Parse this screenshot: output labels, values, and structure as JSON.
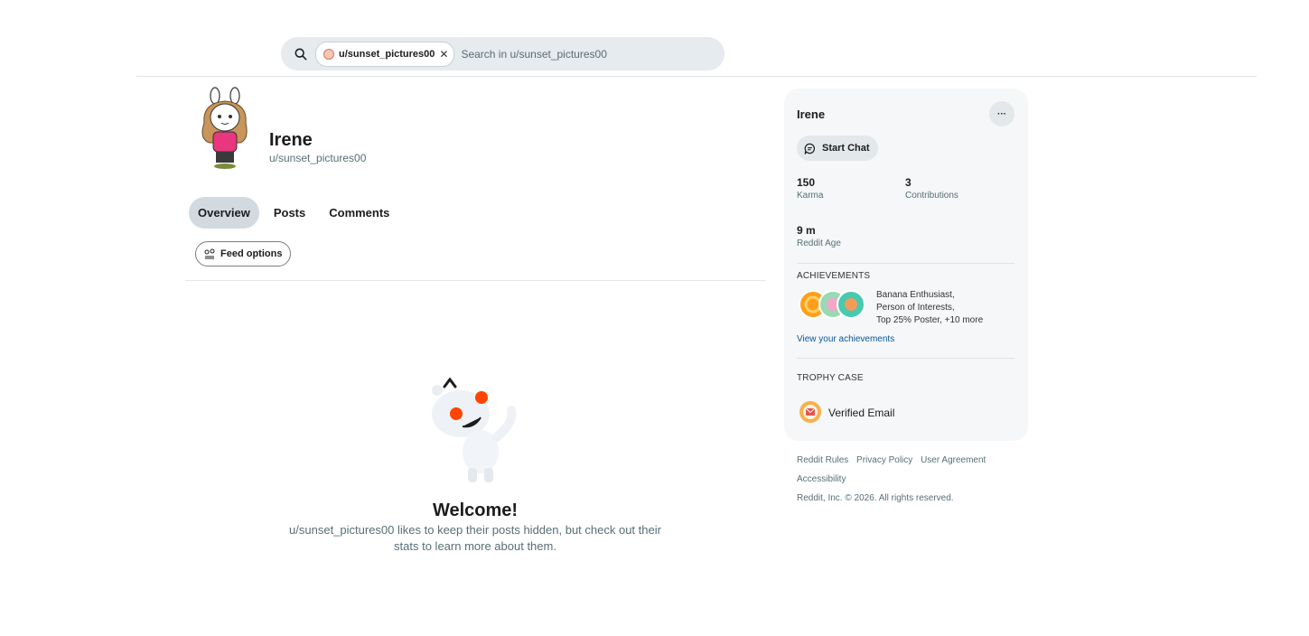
{
  "search": {
    "chip_label": "u/sunset_pictures00",
    "placeholder": "Search in u/sunset_pictures00"
  },
  "profile": {
    "display_name": "Irene",
    "username": "u/sunset_pictures00"
  },
  "tabs": [
    {
      "label": "Overview",
      "active": true
    },
    {
      "label": "Posts",
      "active": false
    },
    {
      "label": "Comments",
      "active": false
    }
  ],
  "feed_options_label": "Feed options",
  "welcome": {
    "title": "Welcome!",
    "description": "u/sunset_pictures00 likes to keep their posts hidden, but check out their stats to learn more about them."
  },
  "sidebar": {
    "name": "Irene",
    "more_label": "···",
    "start_chat_label": "Start Chat",
    "stats": {
      "karma_value": "150",
      "karma_label": "Karma",
      "contrib_value": "3",
      "contrib_label": "Contributions",
      "age_value": "9 m",
      "age_label": "Reddit Age"
    },
    "achievements": {
      "heading": "ACHIEVEMENTS",
      "line1": "Banana Enthusiast,",
      "line2": "Person of Interests,",
      "line3": "Top 25% Poster, +10 more",
      "link": "View your achievements"
    },
    "trophy_case": {
      "heading": "TROPHY CASE",
      "item": "Verified Email"
    }
  },
  "footer": {
    "links": [
      "Reddit Rules",
      "Privacy Policy",
      "User Agreement"
    ],
    "accessibility": "Accessibility",
    "copyright": "Reddit, Inc. © 2026. All rights reserved."
  },
  "colors": {
    "tab_active_bg": "#d2dae0",
    "card_bg": "#f5f7f8",
    "search_bg": "#e5ebee",
    "link": "#0a5699",
    "snoo_eye": "#ff4500"
  },
  "icons": [
    "search-icon",
    "chat-bubble-icon",
    "feed-options-icon",
    "close-icon",
    "more-icon"
  ]
}
